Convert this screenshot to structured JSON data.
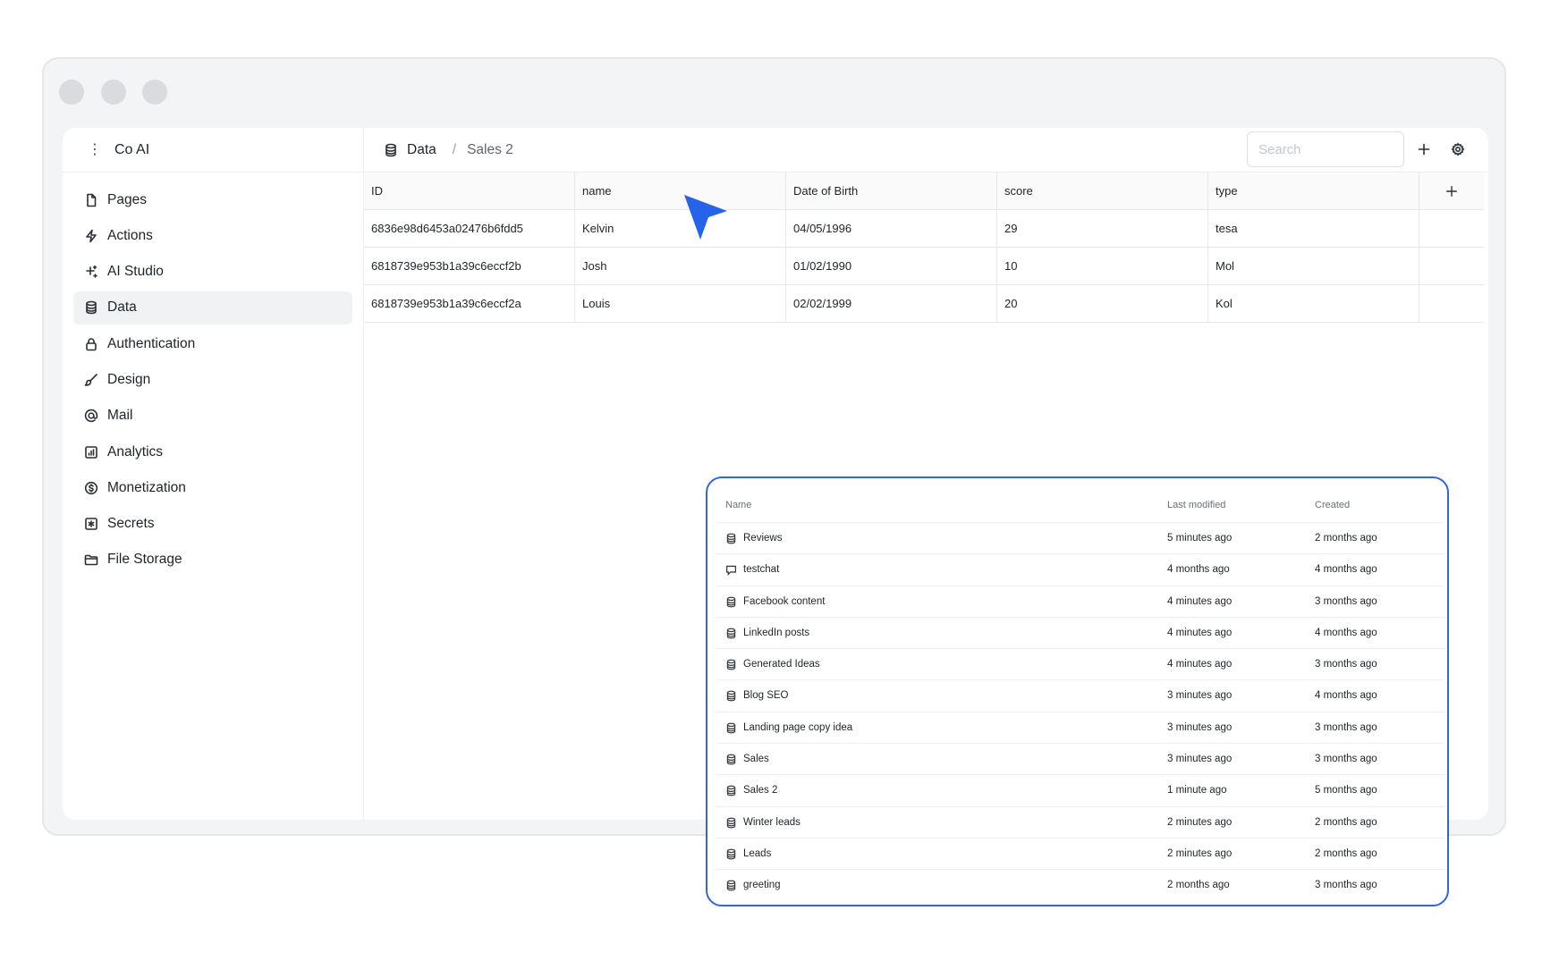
{
  "app": {
    "name": "Co AI"
  },
  "sidebar": {
    "items": [
      {
        "label": "Pages",
        "icon": "file-icon"
      },
      {
        "label": "Actions",
        "icon": "bolt-icon"
      },
      {
        "label": "AI Studio",
        "icon": "sparkles-icon"
      },
      {
        "label": "Data",
        "icon": "database-icon",
        "active": true
      },
      {
        "label": "Authentication",
        "icon": "lock-icon"
      },
      {
        "label": "Design",
        "icon": "brush-icon"
      },
      {
        "label": "Mail",
        "icon": "at-icon"
      },
      {
        "label": "Analytics",
        "icon": "chart-icon"
      },
      {
        "label": "Monetization",
        "icon": "dollar-icon"
      },
      {
        "label": "Secrets",
        "icon": "asterisk-icon"
      },
      {
        "label": "File Storage",
        "icon": "folder-icon"
      }
    ]
  },
  "breadcrumb": {
    "root": "Data",
    "separator": "/",
    "current": "Sales 2"
  },
  "search": {
    "placeholder": "Search",
    "value": ""
  },
  "table": {
    "columns": [
      "ID",
      "name",
      "Date of Birth",
      "score",
      "type"
    ],
    "rows": [
      [
        "6836e98d6453a02476b6fdd5",
        "Kelvin",
        "04/05/1996",
        "29",
        "tesa"
      ],
      [
        "6818739e953b1a39c6eccf2b",
        "Josh",
        "01/02/1990",
        "10",
        "Mol"
      ],
      [
        "6818739e953b1a39c6eccf2a",
        "Louis",
        "02/02/1999",
        "20",
        "Kol"
      ]
    ]
  },
  "collections": {
    "headers": {
      "name": "Name",
      "modified": "Last modified",
      "created": "Created"
    },
    "items": [
      {
        "name": "Reviews",
        "icon": "database-icon",
        "modified": "5 minutes ago",
        "created": "2 months ago"
      },
      {
        "name": "testchat",
        "icon": "chat-icon",
        "modified": "4 months ago",
        "created": "4 months ago"
      },
      {
        "name": "Facebook content",
        "icon": "database-icon",
        "modified": "4 minutes ago",
        "created": "3 months ago"
      },
      {
        "name": "LinkedIn posts",
        "icon": "database-icon",
        "modified": "4 minutes ago",
        "created": "4 months ago"
      },
      {
        "name": "Generated Ideas",
        "icon": "database-icon",
        "modified": "4 minutes ago",
        "created": "3 months ago"
      },
      {
        "name": "Blog SEO",
        "icon": "database-icon",
        "modified": "3 minutes ago",
        "created": "4 months ago"
      },
      {
        "name": "Landing page copy idea",
        "icon": "database-icon",
        "modified": "3 minutes ago",
        "created": "3 months ago"
      },
      {
        "name": "Sales",
        "icon": "database-icon",
        "modified": "3 minutes ago",
        "created": "3 months ago"
      },
      {
        "name": "Sales 2",
        "icon": "database-icon",
        "modified": "1 minute ago",
        "created": "5 months ago"
      },
      {
        "name": "Winter leads",
        "icon": "database-icon",
        "modified": "2 minutes ago",
        "created": "2 months ago"
      },
      {
        "name": "Leads",
        "icon": "database-icon",
        "modified": "2 minutes ago",
        "created": "2 months ago"
      },
      {
        "name": "greeting",
        "icon": "database-icon",
        "modified": "2 months ago",
        "created": "3 months ago"
      }
    ]
  },
  "colors": {
    "accent": "#2f66e0",
    "cursor": "#2563eb"
  }
}
